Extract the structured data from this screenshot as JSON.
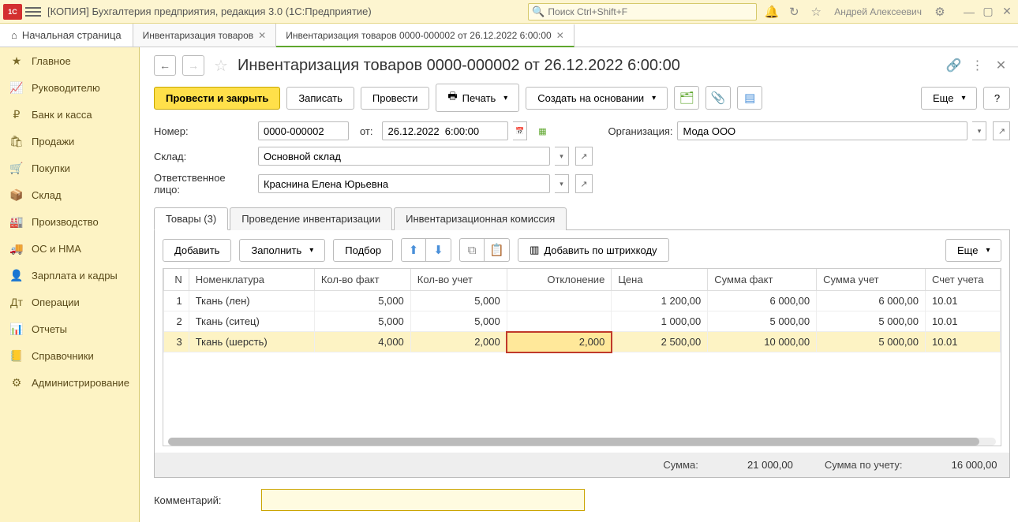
{
  "app": {
    "title": "[КОПИЯ] Бухгалтерия предприятия, редакция 3.0  (1С:Предприятие)",
    "search_placeholder": "Поиск Ctrl+Shift+F",
    "user": "Андрей Алексеевич"
  },
  "tabs": {
    "home": "Начальная страница",
    "t1": "Инвентаризация товаров",
    "t2": "Инвентаризация товаров 0000-000002 от 26.12.2022 6:00:00"
  },
  "sidebar": [
    {
      "label": "Главное",
      "icon": "★"
    },
    {
      "label": "Руководителю",
      "icon": "📈"
    },
    {
      "label": "Банк и касса",
      "icon": "₽"
    },
    {
      "label": "Продажи",
      "icon": "🛍"
    },
    {
      "label": "Покупки",
      "icon": "🛒"
    },
    {
      "label": "Склад",
      "icon": "📦"
    },
    {
      "label": "Производство",
      "icon": "🏭"
    },
    {
      "label": "ОС и НМА",
      "icon": "🚚"
    },
    {
      "label": "Зарплата и кадры",
      "icon": "👤"
    },
    {
      "label": "Операции",
      "icon": "Дт"
    },
    {
      "label": "Отчеты",
      "icon": "📊"
    },
    {
      "label": "Справочники",
      "icon": "📒"
    },
    {
      "label": "Администрирование",
      "icon": "⚙"
    }
  ],
  "doc": {
    "title": "Инвентаризация товаров 0000-000002 от 26.12.2022 6:00:00",
    "btn_post_close": "Провести и закрыть",
    "btn_write": "Записать",
    "btn_post": "Провести",
    "btn_print": "Печать",
    "btn_create": "Создать на основании",
    "btn_more": "Еще",
    "btn_help": "?"
  },
  "form": {
    "label_number": "Номер:",
    "number": "0000-000002",
    "label_from": "от:",
    "date": "26.12.2022  6:00:00",
    "label_org": "Организация:",
    "org": "Мода ООО",
    "label_store": "Склад:",
    "store": "Основной склад",
    "label_resp": "Ответственное лицо:",
    "resp": "Краснина Елена Юрьевна"
  },
  "inner_tabs": {
    "t1": "Товары (3)",
    "t2": "Проведение инвентаризации",
    "t3": "Инвентаризационная комиссия"
  },
  "table_toolbar": {
    "add": "Добавить",
    "fill": "Заполнить",
    "pick": "Подбор",
    "barcode": "Добавить по штрихкоду",
    "more": "Еще"
  },
  "table": {
    "headers": {
      "n": "N",
      "nomen": "Номенклатура",
      "qty_fact": "Кол-во факт",
      "qty_acc": "Кол-во учет",
      "dev": "Отклонение",
      "price": "Цена",
      "sum_fact": "Сумма факт",
      "sum_acc": "Сумма учет",
      "account": "Счет учета"
    },
    "rows": [
      {
        "n": "1",
        "nomen": "Ткань (лен)",
        "qf": "5,000",
        "qa": "5,000",
        "dev": "",
        "price": "1 200,00",
        "sf": "6 000,00",
        "sa": "6 000,00",
        "acc": "10.01"
      },
      {
        "n": "2",
        "nomen": "Ткань (ситец)",
        "qf": "5,000",
        "qa": "5,000",
        "dev": "",
        "price": "1 000,00",
        "sf": "5 000,00",
        "sa": "5 000,00",
        "acc": "10.01"
      },
      {
        "n": "3",
        "nomen": "Ткань (шерсть)",
        "qf": "4,000",
        "qa": "2,000",
        "dev": "2,000",
        "price": "2 500,00",
        "sf": "10 000,00",
        "sa": "5 000,00",
        "acc": "10.01"
      }
    ]
  },
  "totals": {
    "label_sum": "Сумма:",
    "sum": "21 000,00",
    "label_sum_acc": "Сумма по учету:",
    "sum_acc": "16 000,00"
  },
  "comment": {
    "label": "Комментарий:",
    "value": ""
  }
}
